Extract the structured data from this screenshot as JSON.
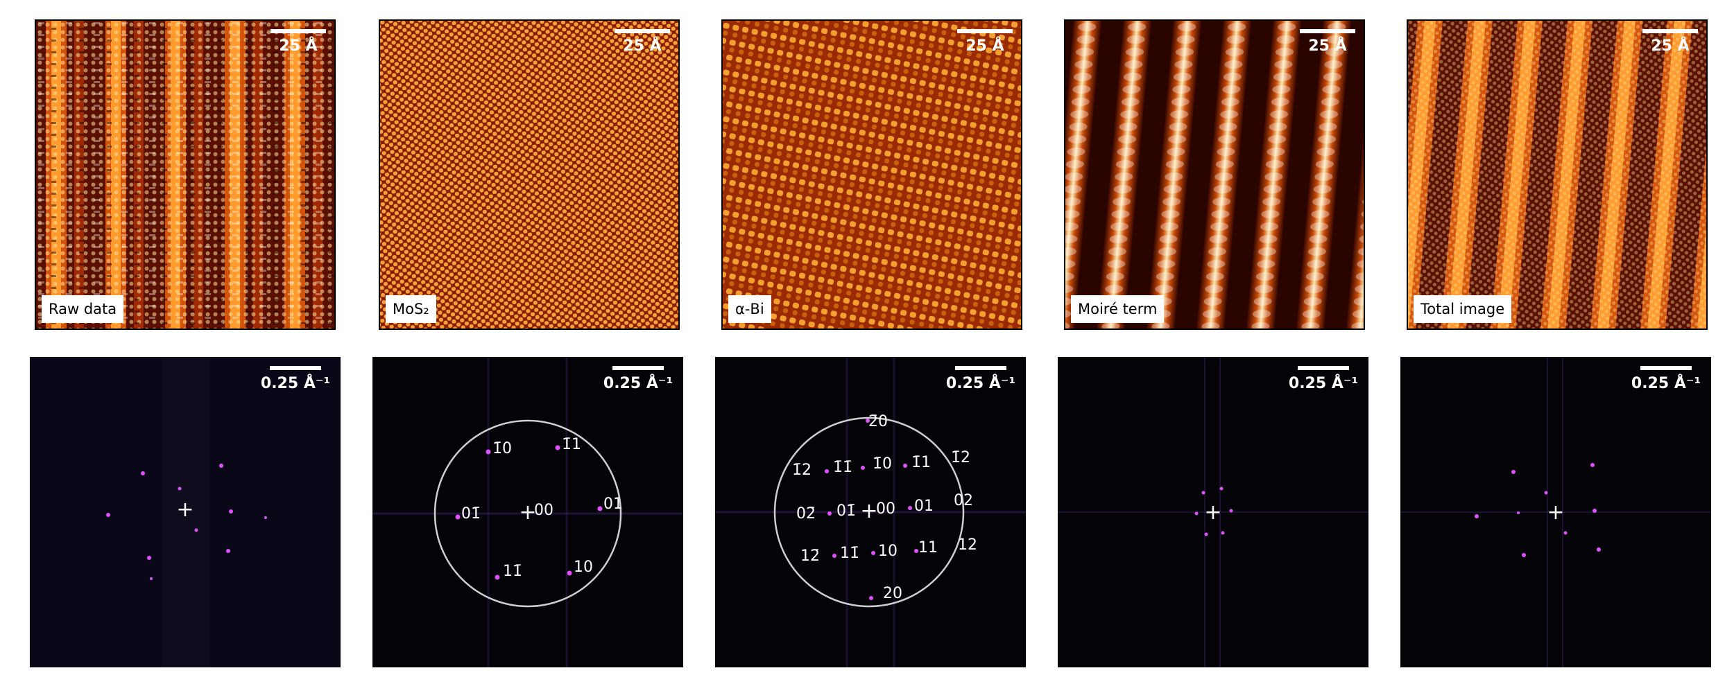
{
  "real_space": [
    {
      "label": "Raw data",
      "scale": "25 Å"
    },
    {
      "label": "MoS₂",
      "scale": "25 Å"
    },
    {
      "label": "α-Bi",
      "scale": "25 Å"
    },
    {
      "label": "Moiré term",
      "scale": "25 Å"
    },
    {
      "label": "Total image",
      "scale": "25 Å"
    }
  ],
  "fourier_space": [
    {
      "scale": "0.25 Å⁻¹",
      "indices": []
    },
    {
      "scale": "0.25 Å⁻¹",
      "indices": [
        "1̄0",
        "1̄1",
        "01̄",
        "00",
        "01",
        "11̄",
        "10"
      ]
    },
    {
      "scale": "0.25 Å⁻¹",
      "indices": [
        "2̄0",
        "1̄2",
        "1̄1̄",
        "1̄0",
        "1̄1",
        "1̄2",
        "02̄",
        "01̄",
        "00",
        "01",
        "02",
        "12̄",
        "11̄",
        "10",
        "11",
        "12",
        "20"
      ]
    },
    {
      "scale": "0.25 Å⁻¹",
      "indices": []
    },
    {
      "scale": "0.25 Å⁻¹",
      "indices": []
    }
  ],
  "colors": {
    "heat_dark": "#2a0500",
    "heat_mid": "#c83a08",
    "heat_bright": "#ffd27a",
    "fft_bg": "#040308",
    "fft_peak": "#d040ff",
    "circle": "#cfcfcf"
  }
}
